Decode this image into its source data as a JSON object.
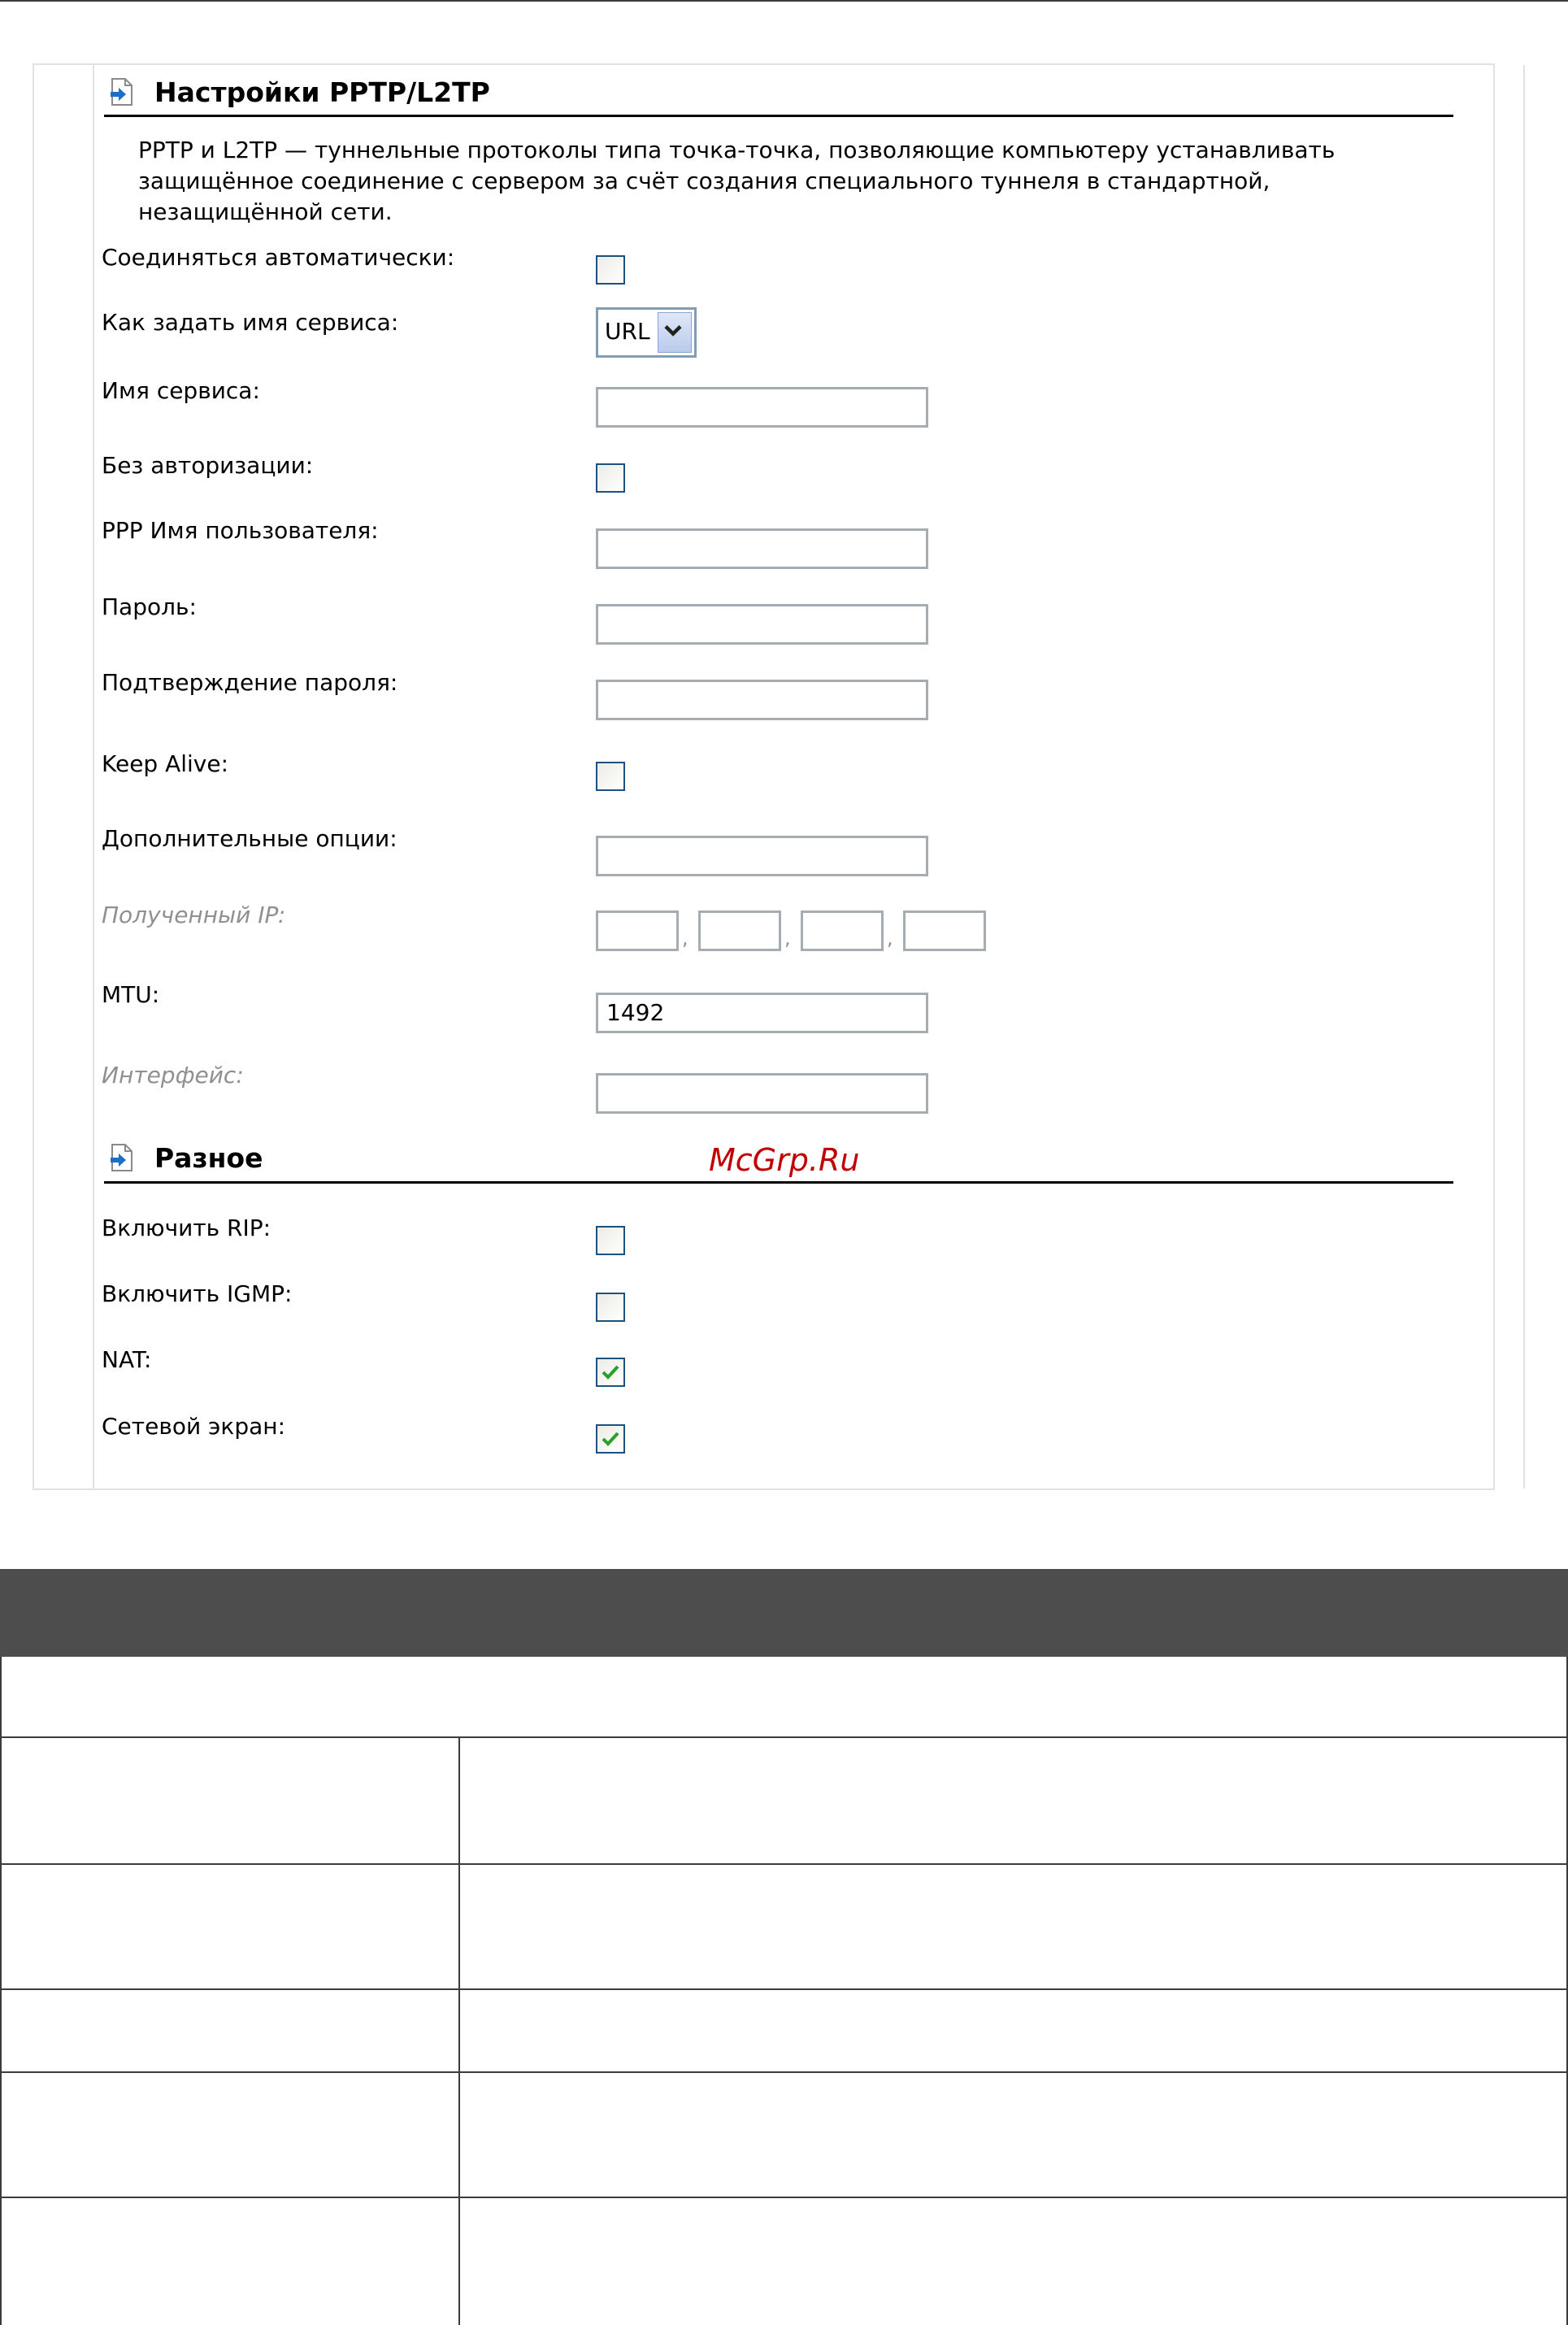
{
  "sections": {
    "pptp_title": "Настройки PPTP/L2TP",
    "misc_title": "Разное"
  },
  "description": "PPTP и L2TP — туннельные протоколы типа точка-точка, позволяющие компьютеру устанавливать защищённое соединение с сервером за счёт создания специального туннеля в стандартной, незащищённой сети.",
  "fields": {
    "auto_connect": {
      "label": "Соединяться автоматически:",
      "checked": false
    },
    "service_name_mode": {
      "label": "Как задать имя сервиса:",
      "value": "URL"
    },
    "service_name": {
      "label": "Имя сервиса:",
      "value": ""
    },
    "no_auth": {
      "label": "Без авторизации:",
      "checked": false
    },
    "ppp_username": {
      "label": "PPP Имя пользователя:",
      "value": ""
    },
    "password": {
      "label": "Пароль:",
      "value": ""
    },
    "password_confirm": {
      "label": "Подтверждение пароля:",
      "value": ""
    },
    "keep_alive": {
      "label": "Keep Alive:",
      "checked": false
    },
    "extra_options": {
      "label": "Дополнительные опции:",
      "value": ""
    },
    "received_ip": {
      "label": "Полученный IP:",
      "octets": [
        "",
        "",
        "",
        ""
      ]
    },
    "mtu": {
      "label": "MTU:",
      "value": "1492"
    },
    "interface": {
      "label": "Интерфейс:",
      "value": ""
    },
    "enable_rip": {
      "label": "Включить RIP:",
      "checked": false
    },
    "enable_igmp": {
      "label": "Включить IGMP:",
      "checked": false
    },
    "nat": {
      "label": "NAT:",
      "checked": true
    },
    "firewall": {
      "label": "Сетевой экран:",
      "checked": true
    }
  },
  "watermark": "McGrp.Ru",
  "colors": {
    "check": "#2aa02a",
    "checkbox_border": "#1c5180",
    "table_header": "#4d4d4d"
  }
}
